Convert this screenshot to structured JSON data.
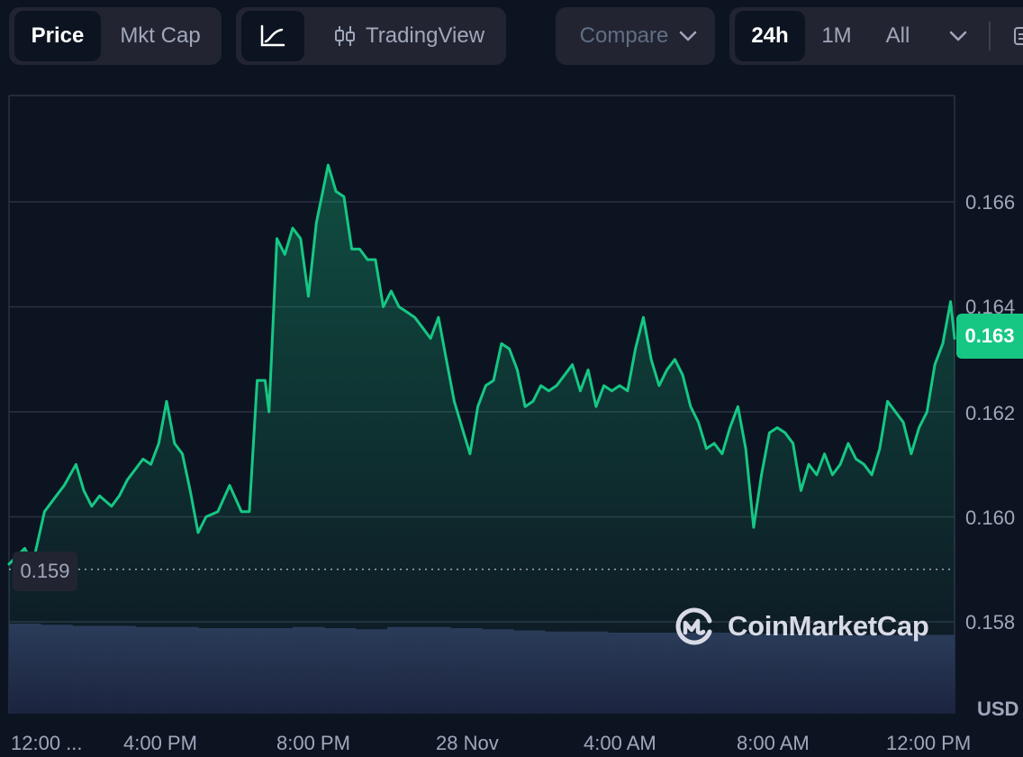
{
  "toolbar": {
    "metric_tabs": [
      {
        "label": "Price",
        "active": true
      },
      {
        "label": "Mkt Cap",
        "active": false
      }
    ],
    "chart_type": {
      "line_icon": "line-chart-icon",
      "candle_icon": "candlestick-icon",
      "tradingview_label": "TradingView"
    },
    "compare": {
      "label": "Compare",
      "icon": "chevron-down-icon"
    },
    "ranges": [
      {
        "label": "24h",
        "active": true
      },
      {
        "label": "1M",
        "active": false
      },
      {
        "label": "All",
        "active": false
      }
    ],
    "more_icon": "chevron-down-icon"
  },
  "badges": {
    "open_price": "0.159",
    "current_price": "0.163"
  },
  "unit": "USD",
  "watermark": "CoinMarketCap",
  "colors": {
    "background": "#0d1421",
    "line": "#16c784",
    "badge_current": "#16c784",
    "volume": "#2a3355",
    "grid": "#2b3142"
  },
  "chart_data": {
    "type": "line",
    "title": "",
    "xlabel": "",
    "ylabel": "",
    "y_tick_labels": [
      "0.166",
      "0.164",
      "0.162",
      "0.160",
      "0.158"
    ],
    "x_tick_labels": [
      "12:00 ...",
      "4:00 PM",
      "8:00 PM",
      "28 Nov",
      "4:00 AM",
      "8:00 AM",
      "12:00 PM"
    ],
    "x_range_hours": [
      0,
      24
    ],
    "ylim": [
      0.1574,
      0.1676
    ],
    "grid": true,
    "reference_line": {
      "value": 0.159,
      "style": "dotted"
    },
    "series": [
      {
        "values": [
          [
            0.0,
            0.1591
          ],
          [
            0.4,
            0.1594
          ],
          [
            0.6,
            0.1591
          ],
          [
            0.9,
            0.1601
          ],
          [
            1.2,
            0.1604
          ],
          [
            1.4,
            0.1606
          ],
          [
            1.7,
            0.161
          ],
          [
            1.9,
            0.1605
          ],
          [
            2.1,
            0.1602
          ],
          [
            2.3,
            0.1604
          ],
          [
            2.6,
            0.1602
          ],
          [
            2.8,
            0.1604
          ],
          [
            3.0,
            0.1607
          ],
          [
            3.2,
            0.1609
          ],
          [
            3.4,
            0.1611
          ],
          [
            3.6,
            0.161
          ],
          [
            3.8,
            0.1614
          ],
          [
            4.0,
            0.1622
          ],
          [
            4.2,
            0.1614
          ],
          [
            4.4,
            0.1612
          ],
          [
            4.6,
            0.1605
          ],
          [
            4.8,
            0.1597
          ],
          [
            5.0,
            0.16
          ],
          [
            5.3,
            0.1601
          ],
          [
            5.6,
            0.1606
          ],
          [
            5.9,
            0.1601
          ],
          [
            6.1,
            0.1601
          ],
          [
            6.3,
            0.1626
          ],
          [
            6.5,
            0.1626
          ],
          [
            6.6,
            0.162
          ],
          [
            6.8,
            0.1653
          ],
          [
            7.0,
            0.165
          ],
          [
            7.2,
            0.1655
          ],
          [
            7.4,
            0.1653
          ],
          [
            7.6,
            0.1642
          ],
          [
            7.8,
            0.1656
          ],
          [
            8.1,
            0.1667
          ],
          [
            8.3,
            0.1662
          ],
          [
            8.5,
            0.1661
          ],
          [
            8.7,
            0.1651
          ],
          [
            8.9,
            0.1651
          ],
          [
            9.1,
            0.1649
          ],
          [
            9.3,
            0.1649
          ],
          [
            9.5,
            0.164
          ],
          [
            9.7,
            0.1643
          ],
          [
            9.9,
            0.164
          ],
          [
            10.1,
            0.1639
          ],
          [
            10.3,
            0.1638
          ],
          [
            10.5,
            0.1636
          ],
          [
            10.7,
            0.1634
          ],
          [
            10.9,
            0.1638
          ],
          [
            11.1,
            0.163
          ],
          [
            11.3,
            0.1622
          ],
          [
            11.5,
            0.1617
          ],
          [
            11.7,
            0.1612
          ],
          [
            11.9,
            0.1621
          ],
          [
            12.1,
            0.1625
          ],
          [
            12.3,
            0.1626
          ],
          [
            12.5,
            0.1633
          ],
          [
            12.7,
            0.1632
          ],
          [
            12.9,
            0.1628
          ],
          [
            13.1,
            0.1621
          ],
          [
            13.3,
            0.1622
          ],
          [
            13.5,
            0.1625
          ],
          [
            13.7,
            0.1624
          ],
          [
            13.9,
            0.1625
          ],
          [
            14.1,
            0.1627
          ],
          [
            14.3,
            0.1629
          ],
          [
            14.5,
            0.1624
          ],
          [
            14.7,
            0.1628
          ],
          [
            14.9,
            0.1621
          ],
          [
            15.1,
            0.1625
          ],
          [
            15.3,
            0.1624
          ],
          [
            15.5,
            0.1625
          ],
          [
            15.7,
            0.1624
          ],
          [
            15.9,
            0.1632
          ],
          [
            16.1,
            0.1638
          ],
          [
            16.3,
            0.163
          ],
          [
            16.5,
            0.1625
          ],
          [
            16.7,
            0.1628
          ],
          [
            16.9,
            0.163
          ],
          [
            17.1,
            0.1627
          ],
          [
            17.3,
            0.1621
          ],
          [
            17.5,
            0.1618
          ],
          [
            17.7,
            0.1613
          ],
          [
            17.9,
            0.1614
          ],
          [
            18.1,
            0.1612
          ],
          [
            18.3,
            0.1617
          ],
          [
            18.5,
            0.1621
          ],
          [
            18.7,
            0.1613
          ],
          [
            18.9,
            0.1598
          ],
          [
            19.1,
            0.1608
          ],
          [
            19.3,
            0.1616
          ],
          [
            19.5,
            0.1617
          ],
          [
            19.7,
            0.1616
          ],
          [
            19.9,
            0.1614
          ],
          [
            20.1,
            0.1605
          ],
          [
            20.3,
            0.161
          ],
          [
            20.5,
            0.1608
          ],
          [
            20.7,
            0.1612
          ],
          [
            20.9,
            0.1608
          ],
          [
            21.1,
            0.161
          ],
          [
            21.3,
            0.1614
          ],
          [
            21.5,
            0.1611
          ],
          [
            21.7,
            0.161
          ],
          [
            21.9,
            0.1608
          ],
          [
            22.1,
            0.1613
          ],
          [
            22.3,
            0.1622
          ],
          [
            22.5,
            0.162
          ],
          [
            22.7,
            0.1618
          ],
          [
            22.9,
            0.1612
          ],
          [
            23.1,
            0.1617
          ],
          [
            23.3,
            0.162
          ],
          [
            23.5,
            0.1629
          ],
          [
            23.7,
            0.1633
          ],
          [
            23.9,
            0.1641
          ],
          [
            24.0,
            0.1634
          ]
        ]
      }
    ],
    "volume": {
      "values": [
        0.8,
        0.79,
        0.78,
        0.78,
        0.77,
        0.77,
        0.76,
        0.76,
        0.76,
        0.77,
        0.76,
        0.75,
        0.77,
        0.77,
        0.76,
        0.75,
        0.74,
        0.73,
        0.73,
        0.72,
        0.72,
        0.72,
        0.72,
        0.71,
        0.71,
        0.71,
        0.7,
        0.7,
        0.7,
        0.7
      ]
    }
  }
}
